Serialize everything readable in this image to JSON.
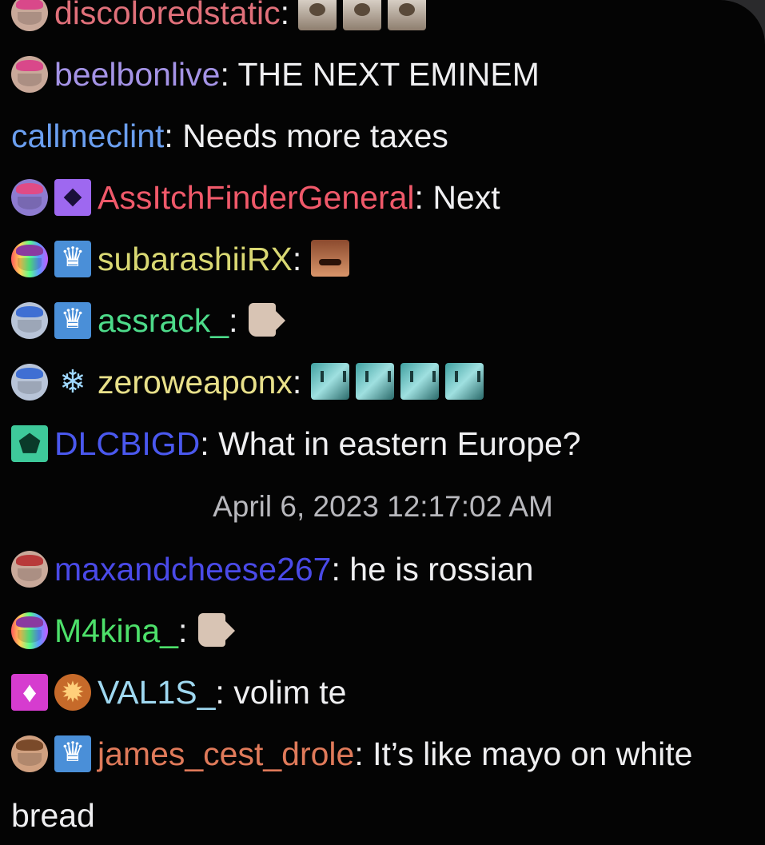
{
  "colors": {
    "background": "#040404",
    "message_text": "#efeff1",
    "timestamp_text": "#b8b8bd"
  },
  "messages": [
    {
      "username": "discoloredstatic",
      "user_color": "#e0707a",
      "badges": [
        "avatar-pink"
      ],
      "text": "",
      "emotes": [
        "cat-emote",
        "cat-emote",
        "cat-emote"
      ]
    },
    {
      "username": "beelbonlive",
      "user_color": "#a493e6",
      "badges": [
        "avatar-pink"
      ],
      "text": "THE NEXT EMINEM",
      "emotes": []
    },
    {
      "username": "callmeclint",
      "user_color": "#6b9ff0",
      "badges": [],
      "text": "Needs more taxes",
      "emotes": []
    },
    {
      "username": "AssItchFinderGeneral",
      "user_color": "#f0596a",
      "badges": [
        "avatar-purple",
        "sub-diamond"
      ],
      "text": "Next",
      "emotes": []
    },
    {
      "username": "subarashiiRX",
      "user_color": "#d9d873",
      "badges": [
        "avatar-rainbow",
        "sub-crown"
      ],
      "text": "",
      "emotes": [
        "laughing-face-emote"
      ]
    },
    {
      "username": "assrack_",
      "user_color": "#4ddb8a",
      "badges": [
        "avatar-blue",
        "sub-crown"
      ],
      "text": "",
      "emotes": [
        "point-right-hand-emote"
      ]
    },
    {
      "username": "zeroweaponx",
      "user_color": "#e8e08a",
      "badges": [
        "avatar-blue",
        "sub-snowflake"
      ],
      "text": "",
      "emotes": [
        "teal-cat-emote",
        "teal-cat-emote",
        "teal-cat-emote",
        "teal-cat-emote"
      ]
    },
    {
      "username": "DLCBIGD",
      "user_color": "#4a58ee",
      "badges": [
        "sub-pentagon"
      ],
      "text": "What in eastern Europe?",
      "emotes": []
    }
  ],
  "timestamp": "April 6, 2023 12:17:02 AM",
  "messages_after": [
    {
      "username": "maxandcheese267",
      "user_color": "#4a4ae8",
      "badges": [
        "avatar-red"
      ],
      "text": "he is rossian",
      "emotes": []
    },
    {
      "username": "M4kina_",
      "user_color": "#4de06a",
      "badges": [
        "avatar-rainbow"
      ],
      "text": "",
      "emotes": [
        "point-right-hand-emote"
      ]
    },
    {
      "username": "VAL1S_",
      "user_color": "#9fd8f0",
      "badges": [
        "sub-gem",
        "sub-lion"
      ],
      "text": "volim te",
      "emotes": []
    },
    {
      "username": "james_cest_drole",
      "user_color": "#e07a5a",
      "badges": [
        "avatar-brown",
        "sub-crown"
      ],
      "text": "It’s like mayo on white bread",
      "emotes": []
    }
  ]
}
